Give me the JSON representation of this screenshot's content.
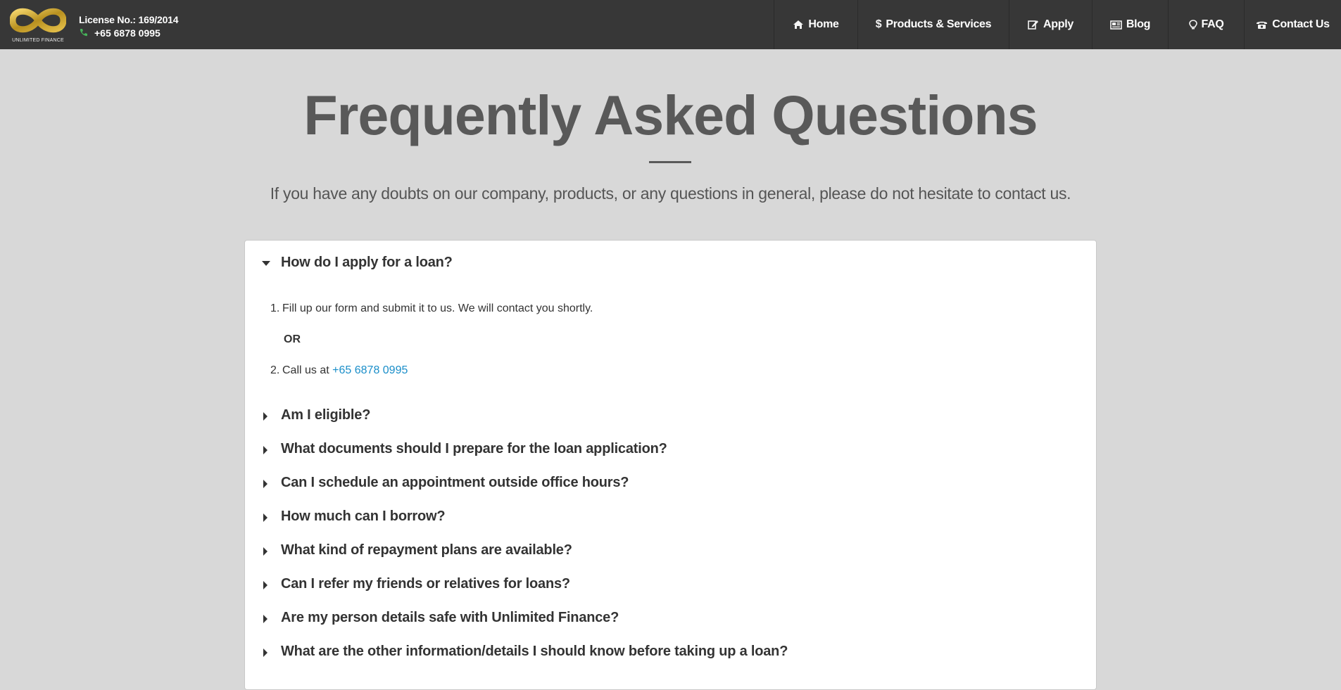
{
  "header": {
    "logo_text": "UNLIMITED FINANCE",
    "license": "License No.: 169/2014",
    "phone": "+65 6878 0995",
    "nav": [
      {
        "label": "Home",
        "icon": "home-icon"
      },
      {
        "label": "Products & Services",
        "icon": "dollar-icon"
      },
      {
        "label": "Apply",
        "icon": "edit-icon"
      },
      {
        "label": "Blog",
        "icon": "newspaper-icon"
      },
      {
        "label": "FAQ",
        "icon": "lightbulb-icon"
      },
      {
        "label": "Contact Us",
        "icon": "phone-icon"
      }
    ]
  },
  "hero": {
    "title": "Frequently Asked Questions",
    "subtitle": "If you have any doubts on our company, products, or any questions in general, please do not hesitate to contact us."
  },
  "faq": {
    "open_question": "How do I apply for a loan?",
    "answer": {
      "step1_num": "1.",
      "step1": "Fill up our form and submit it to us. We will contact you shortly.",
      "or": "OR",
      "step2_num": "2.",
      "step2_prefix": "Call us at",
      "step2_link": "+65 6878 0995"
    },
    "questions": [
      "Am I eligible?",
      "What documents should I prepare for the loan application?",
      "Can I schedule an appointment outside office hours?",
      "How much can I borrow?",
      "What kind of repayment plans are available?",
      "Can I refer my friends or relatives for loans?",
      "Are my person details safe with Unlimited Finance?",
      "What are the other information/details I should know before taking up a loan?"
    ]
  },
  "colors": {
    "topbar": "#373737",
    "background": "#d8d8d8",
    "title": "#595959",
    "link": "#1a8ec9",
    "phone_icon": "#46b35a",
    "logo_gold": "#c9a227"
  }
}
